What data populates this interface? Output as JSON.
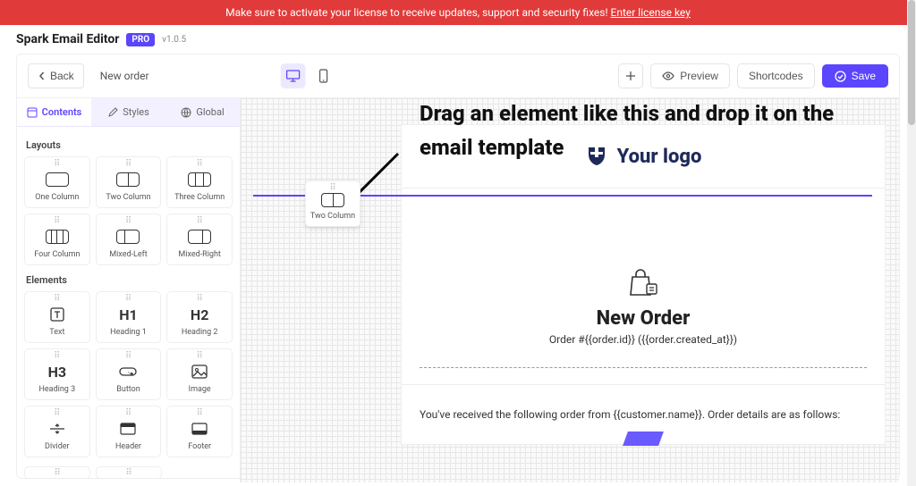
{
  "banner": {
    "message": "Make sure to activate your license to receive updates, support and security fixes! ",
    "link_text": "Enter license key"
  },
  "brand": {
    "name": "Spark Email Editor",
    "badge": "PRO",
    "version": "v1.0.5"
  },
  "toolbar": {
    "back": "Back",
    "breadcrumb": "New order",
    "preview": "Preview",
    "shortcodes": "Shortcodes",
    "save": "Save"
  },
  "sidebar": {
    "tabs": {
      "contents": "Contents",
      "styles": "Styles",
      "global": "Global"
    },
    "layouts_title": "Layouts",
    "layouts": [
      {
        "label": "One Column"
      },
      {
        "label": "Two Column"
      },
      {
        "label": "Three Column"
      },
      {
        "label": "Four Column"
      },
      {
        "label": "Mixed-Left"
      },
      {
        "label": "Mixed-Right"
      }
    ],
    "elements_title": "Elements",
    "elements": [
      {
        "label": "Text",
        "glyph": "T"
      },
      {
        "label": "Heading 1",
        "glyph": "H1"
      },
      {
        "label": "Heading 2",
        "glyph": "H2"
      },
      {
        "label": "Heading 3",
        "glyph": "H3"
      },
      {
        "label": "Button",
        "glyph": "btn"
      },
      {
        "label": "Image",
        "glyph": "img"
      },
      {
        "label": "Divider",
        "glyph": "div"
      },
      {
        "label": "Header",
        "glyph": "hdr"
      },
      {
        "label": "Footer",
        "glyph": "ftr"
      }
    ]
  },
  "canvas": {
    "hint": "Drag an element like this and drop it on the email template",
    "drag_ghost_label": "Two Column",
    "logo_text": "Your logo",
    "order_title": "New Order",
    "order_sub": "Order #{{order.id}} ({{order.created_at}})",
    "order_msg": "You've received the following order from {{customer.name}}. Order details are as follows:"
  }
}
